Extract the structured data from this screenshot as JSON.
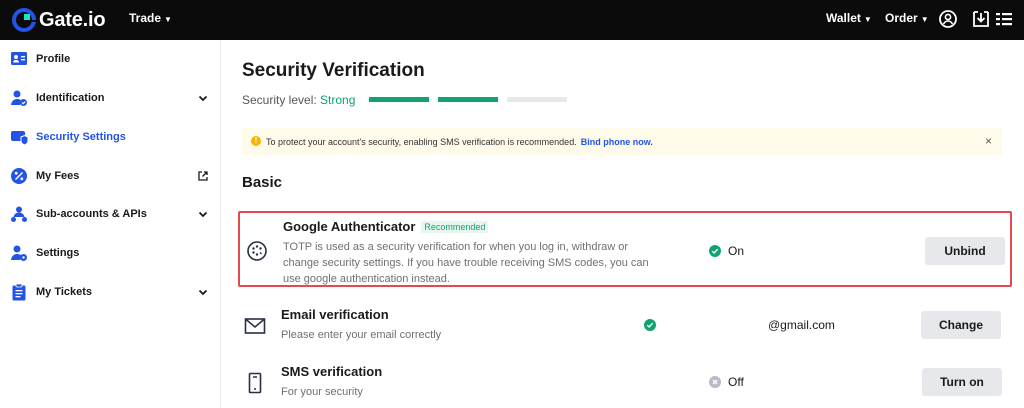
{
  "topbar": {
    "brand": "Gate.io",
    "nav": {
      "trade": "Trade",
      "wallet": "Wallet",
      "order": "Order"
    },
    "icons": [
      "gate-logo-icon",
      "user-circle-icon",
      "download-icon",
      "menu-icon"
    ]
  },
  "sidebar": {
    "items": [
      {
        "label": "Profile",
        "icon": "profile-card-icon",
        "expandable": false
      },
      {
        "label": "Identification",
        "icon": "user-verify-icon",
        "expandable": true
      },
      {
        "label": "Security Settings",
        "icon": "security-icon",
        "expandable": false,
        "active": true
      },
      {
        "label": "My Fees",
        "icon": "percent-icon",
        "external": true
      },
      {
        "label": "Sub-accounts & APIs",
        "icon": "sub-accounts-icon",
        "expandable": true
      },
      {
        "label": "Settings",
        "icon": "user-settings-icon",
        "expandable": false
      },
      {
        "label": "My Tickets",
        "icon": "clipboard-icon",
        "expandable": true
      }
    ]
  },
  "main": {
    "title": "Security Verification",
    "security_level_label": "Security level:",
    "security_level_value": "Strong",
    "security_level_filled": 2,
    "security_level_total": 3,
    "notice": {
      "text": "To protect your account's security, enabling SMS verification is recommended.",
      "link": "Bind phone now.",
      "close": "×"
    },
    "section_title": "Basic",
    "rows": [
      {
        "title": "Google Authenticator",
        "badge": "Recommended",
        "desc_line1": "TOTP is used as a security verification for when you log in, withdraw or",
        "desc_line2": "change security settings. If you have trouble receiving SMS codes, you can",
        "desc_line3": "use google authentication instead.",
        "status": "On",
        "button": "Unbind"
      },
      {
        "title": "Email verification",
        "desc": "Please enter your email correctly",
        "status_value": "@gmail.com",
        "button": "Change"
      },
      {
        "title": "SMS verification",
        "desc": "For your security",
        "status": "Off",
        "button": "Turn on"
      }
    ]
  },
  "colors": {
    "accent": "#2354e6",
    "success": "#10a36e",
    "warning": "#f7b500",
    "highlight": "#e5484d",
    "topbar": "#0b0b0b"
  }
}
